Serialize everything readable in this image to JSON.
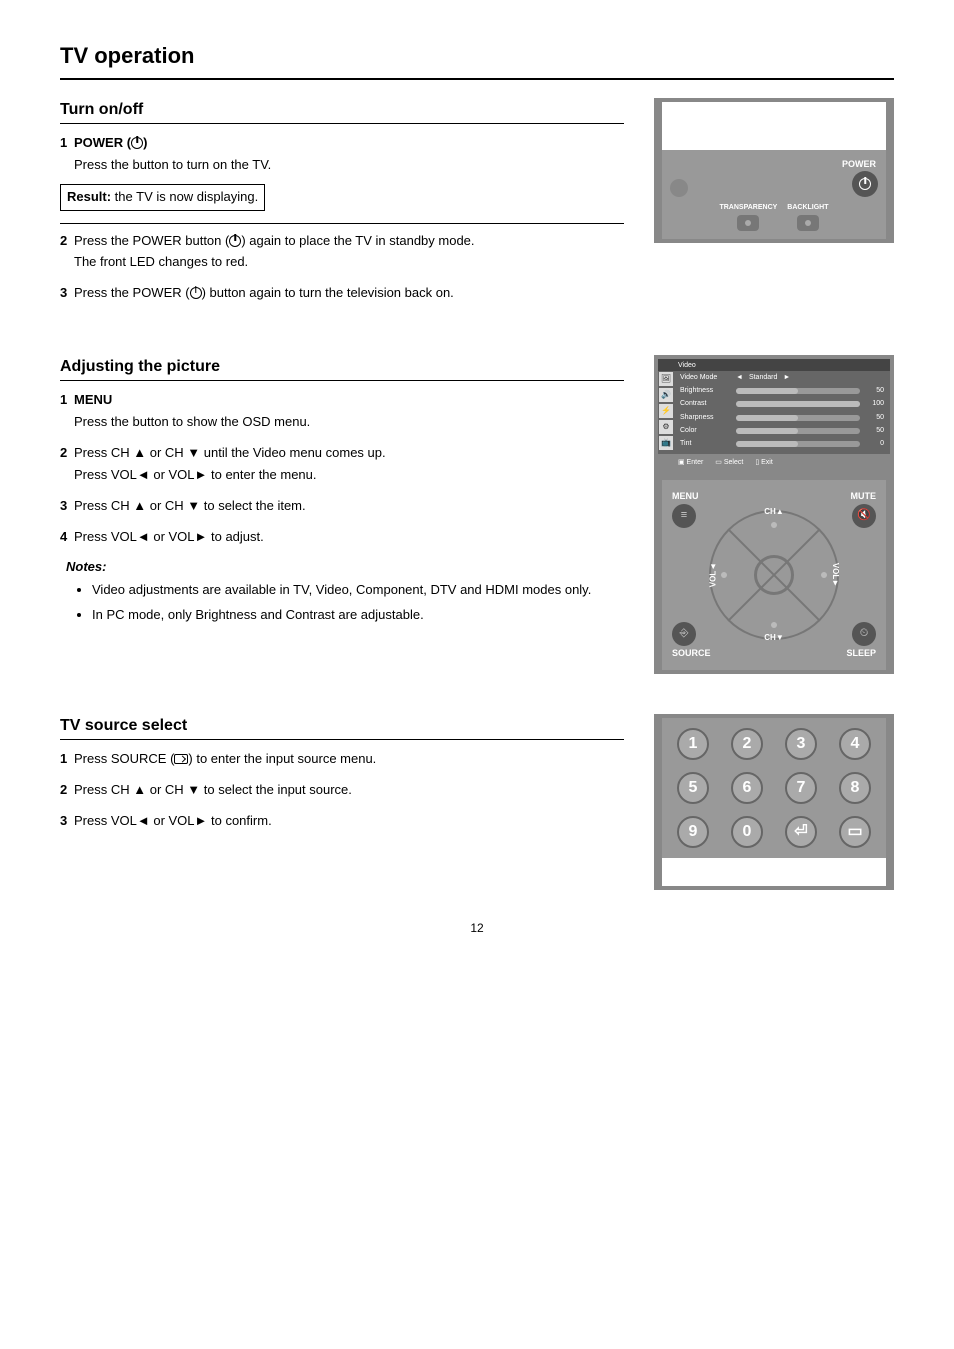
{
  "page_title": "TV operation",
  "power": {
    "section": "Turn on/off",
    "step1_head": "POWER (",
    "step1_tail": ")",
    "step1_desc": "Press the button to turn on the TV.",
    "result1_label": "Result:",
    "result1_text": " the TV is now displaying.",
    "step2_a": "Press the POWER button (",
    "step2_b": ") again to place the TV in standby mode.",
    "step2_c": "The front LED changes to red.",
    "step3_a": "Press the POWER (",
    "step3_b": ") button again to turn the television back on.",
    "labels": {
      "power": "POWER",
      "transparency": "TRANSPARENCY",
      "backlight": "BACKLIGHT"
    }
  },
  "picture": {
    "section": "Adjusting the picture",
    "step1_head": "MENU",
    "step1_desc": "Press the button to show the OSD menu.",
    "step2_a": "Press CH ▲ or CH ▼ until the Video menu comes up.",
    "step2_b": "Press VOL◄ or VOL► to enter the menu.",
    "step3": "Press CH ▲ or CH ▼ to select the item.",
    "step4": "Press VOL◄ or VOL► to adjust.",
    "notes_title": "Notes:",
    "note1": "Video adjustments are available in TV, Video, Component, DTV and HDMI modes only.",
    "note2": "In PC mode, only Brightness and Contrast are adjustable.",
    "osd": {
      "title": "Video",
      "tabs": [
        "🖼",
        "🔊",
        "⚡",
        "⚙",
        "📺"
      ],
      "rows": [
        {
          "label": "Video Mode",
          "value": "Standard",
          "fill": 0
        },
        {
          "label": "Brightness",
          "value": "50",
          "fill": 50
        },
        {
          "label": "Contrast",
          "value": "100",
          "fill": 100
        },
        {
          "label": "Sharpness",
          "value": "50",
          "fill": 50
        },
        {
          "label": "Color",
          "value": "50",
          "fill": 50
        },
        {
          "label": "Tint",
          "value": "0",
          "fill": 50
        }
      ],
      "bottom": [
        "▣ Enter",
        "▭ Select",
        "▯ Exit"
      ]
    },
    "nav": {
      "menu": "MENU",
      "mute": "MUTE",
      "source": "SOURCE",
      "sleep": "SLEEP",
      "chup": "CH▲",
      "chdn": "CH▼",
      "voll": "VOL◄",
      "volr": "VOL►"
    }
  },
  "source": {
    "section": "TV source select",
    "step1_a": "Press SOURCE (",
    "step1_b": ") to enter the input source menu.",
    "step2": "Press CH ▲ or CH ▼ to select the input source.",
    "step3": "Press VOL◄ or VOL► to confirm.",
    "keys": [
      "1",
      "2",
      "3",
      "4",
      "5",
      "6",
      "7",
      "8",
      "9",
      "0",
      "⏎",
      "▭"
    ]
  },
  "page_number": "12"
}
